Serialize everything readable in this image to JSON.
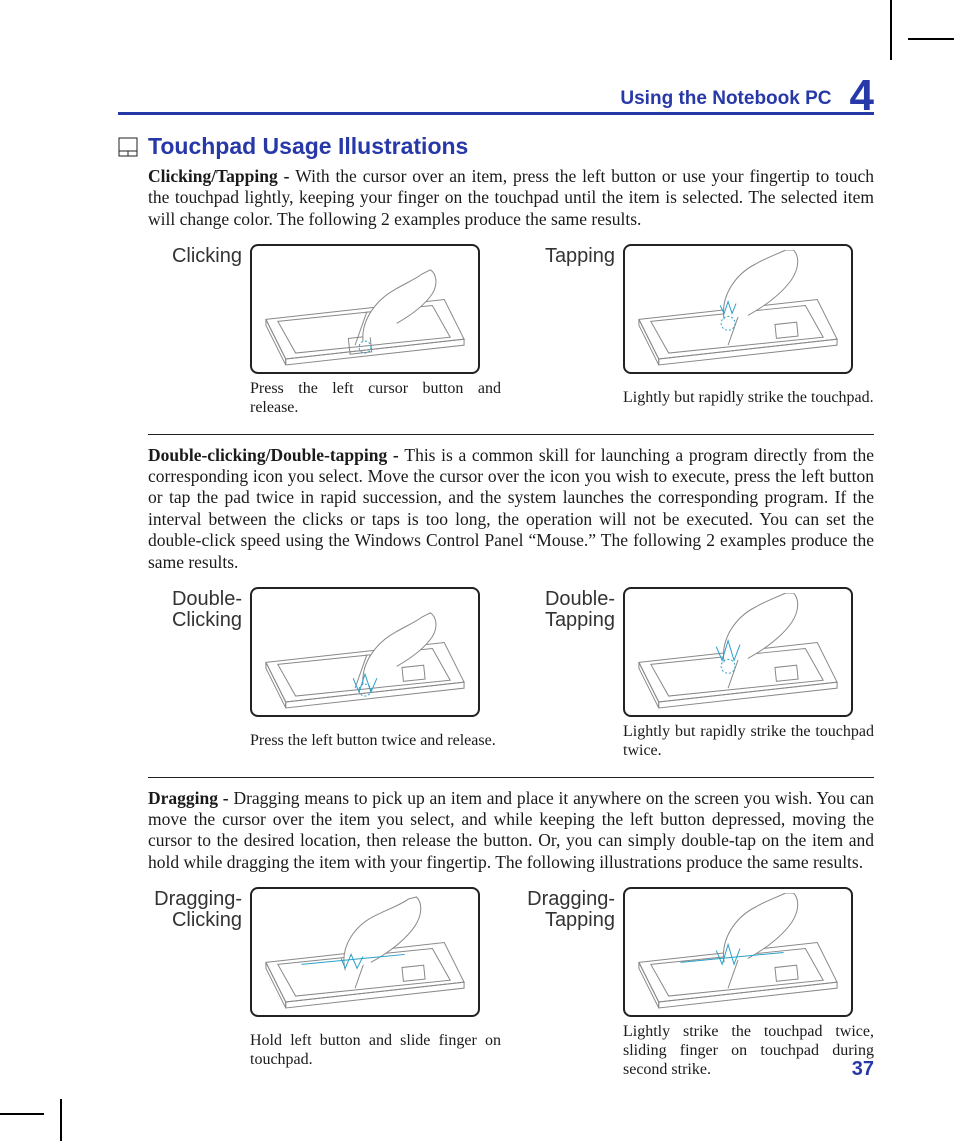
{
  "header": {
    "title": "Using the Notebook PC",
    "chapter": "4"
  },
  "page_number": "37",
  "section": {
    "title": "Touchpad Usage Illustrations"
  },
  "para1": {
    "lead": "Clicking/Tapping - ",
    "rest": "With the cursor over an item, press the left button or use your fingertip to touch the touchpad lightly, keeping your finger on the touchpad until the item is selected. The selected item will change color. The following 2 examples produce the same results."
  },
  "grid1": {
    "left": {
      "label": "Clicking",
      "caption": "Press the left cursor button and release."
    },
    "right": {
      "label": "Tapping",
      "caption": "Lightly but rapidly strike the touchpad."
    }
  },
  "para2": {
    "lead": "Double-clicking/Double-tapping - ",
    "rest": "This is a common skill for launching a program directly from the corresponding icon you select. Move the cursor over the icon you wish to execute, press the left button or tap the pad twice in rapid succession, and the system launches the corresponding program. If the interval between the clicks or taps is too long, the operation will not be executed. You can set the double-click speed using the Windows Control Panel “Mouse.” The following 2 examples produce the same results."
  },
  "grid2": {
    "left": {
      "label": "Double-\nClicking",
      "caption": "Press the left button twice and release."
    },
    "right": {
      "label": "Double-\nTapping",
      "caption": "Lightly but rapidly strike the touchpad twice."
    }
  },
  "para3": {
    "lead": "Dragging - ",
    "rest": "Dragging means to pick up an item and place it anywhere on the screen you wish. You can move the cursor over the item you select, and while keeping the left button depressed, moving the cursor to the desired location, then release the button. Or, you can simply double-tap on the item and hold while dragging the item with your fingertip. The following illustrations produce the same results."
  },
  "grid3": {
    "left": {
      "label": "Dragging-\nClicking",
      "caption": "Hold left button and slide finger on touchpad."
    },
    "right": {
      "label": "Dragging-\nTapping",
      "caption": "Lightly strike the touchpad twice, sliding finger on touchpad during second strike."
    }
  }
}
